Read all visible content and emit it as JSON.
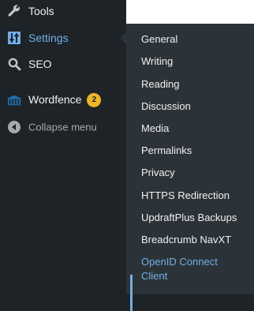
{
  "menu": {
    "tools": {
      "label": "Tools",
      "icon": "wrench-icon"
    },
    "settings": {
      "label": "Settings",
      "icon": "settings-sliders-icon"
    },
    "seo": {
      "label": "SEO",
      "icon": "search-icon"
    },
    "wordfence": {
      "label": "Wordfence",
      "icon": "wordfence-icon",
      "badge": "2"
    },
    "collapse": {
      "label": "Collapse menu",
      "icon": "collapse-arrow-icon"
    }
  },
  "submenu": {
    "items": [
      {
        "label": "General"
      },
      {
        "label": "Writing"
      },
      {
        "label": "Reading"
      },
      {
        "label": "Discussion"
      },
      {
        "label": "Media"
      },
      {
        "label": "Permalinks"
      },
      {
        "label": "Privacy"
      },
      {
        "label": "HTTPS Redirection"
      },
      {
        "label": "UpdraftPlus Backups"
      },
      {
        "label": "Breadcrumb NavXT"
      },
      {
        "label_line1": "OpenID Connect",
        "label_line2": "Client"
      }
    ]
  },
  "colors": {
    "menu_bg": "#1d2327",
    "submenu_bg": "#2c3338",
    "accent": "#72aee6",
    "badge": "#f0b429"
  }
}
